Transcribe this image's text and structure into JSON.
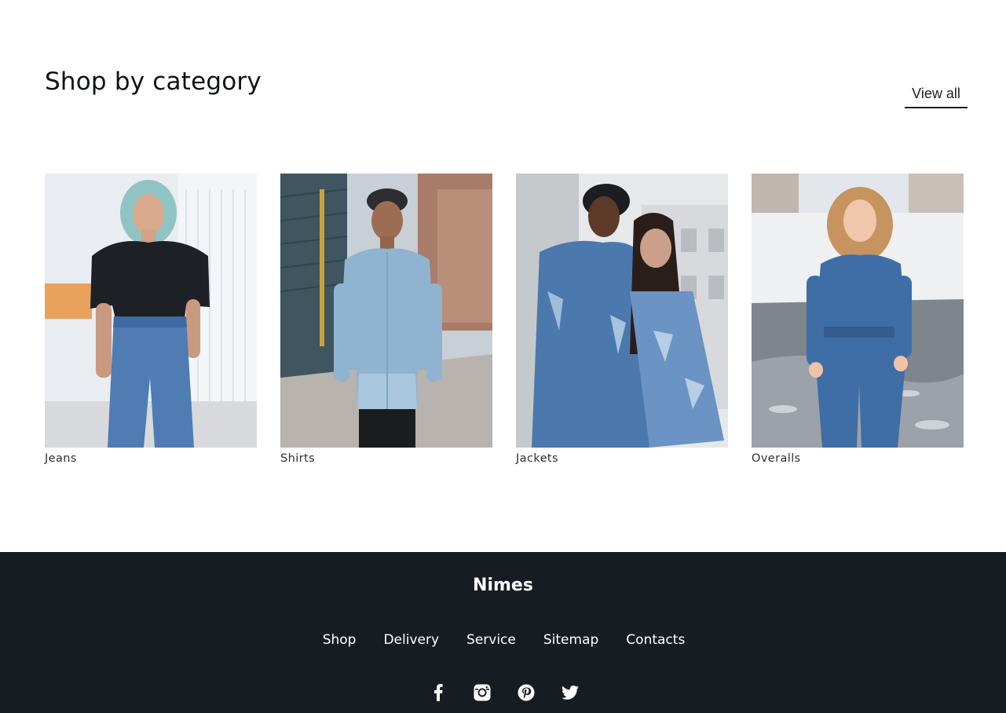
{
  "section": {
    "title": "Shop by category",
    "view_all_label": "View all"
  },
  "categories": [
    {
      "label": "Jeans"
    },
    {
      "label": "Shirts"
    },
    {
      "label": "Jackets"
    },
    {
      "label": "Overalls"
    }
  ],
  "footer": {
    "brand": "Nimes",
    "nav": [
      "Shop",
      "Delivery",
      "Service",
      "Sitemap",
      "Contacts"
    ],
    "socials": [
      "facebook-icon",
      "instagram-icon",
      "pinterest-icon",
      "twitter-icon"
    ]
  },
  "colors": {
    "footer_bg": "#171c22",
    "text_dark": "#0f1216",
    "denim": "#4a78b0"
  }
}
